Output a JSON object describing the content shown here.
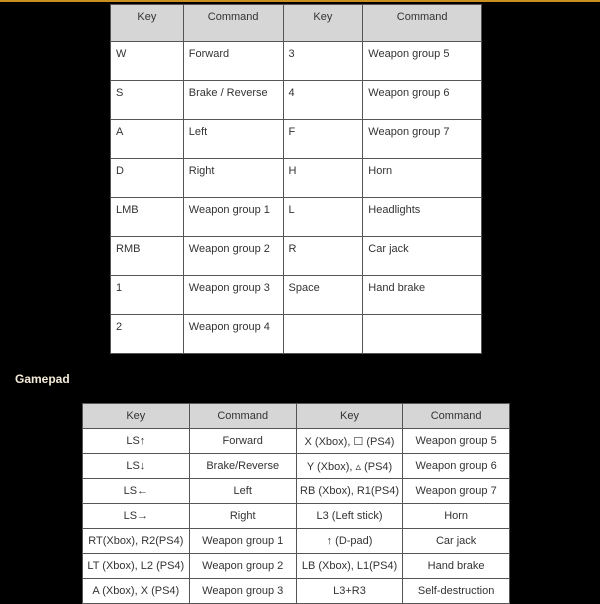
{
  "accent_color": "#c8901c",
  "keyboard": {
    "headers": [
      "Key",
      "Command",
      "Key",
      "Command"
    ],
    "rows": [
      {
        "key1": "W",
        "cmd1": "Forward",
        "key2": "3",
        "cmd2": "Weapon group 5"
      },
      {
        "key1": "S",
        "cmd1": "Brake / Reverse",
        "key2": "4",
        "cmd2": "Weapon group 6"
      },
      {
        "key1": "A",
        "cmd1": "Left",
        "key2": "F",
        "cmd2": "Weapon group 7"
      },
      {
        "key1": "D",
        "cmd1": "Right",
        "key2": "H",
        "cmd2": "Horn"
      },
      {
        "key1": "LMB",
        "cmd1": "Weapon group 1",
        "key2": "L",
        "cmd2": "Headlights"
      },
      {
        "key1": "RMB",
        "cmd1": "Weapon group 2",
        "key2": "R",
        "cmd2": "Car jack"
      },
      {
        "key1": "1",
        "cmd1": "Weapon group 3",
        "key2": "Space",
        "cmd2": "Hand brake"
      },
      {
        "key1": "2",
        "cmd1": "Weapon group 4",
        "key2": "",
        "cmd2": ""
      }
    ]
  },
  "gamepad": {
    "heading": "Gamepad",
    "headers": [
      "Key",
      "Command",
      "Key",
      "Command"
    ],
    "rows": [
      {
        "key1": "LS↑",
        "cmd1": "Forward",
        "key2": "X (Xbox), ☐ (PS4)",
        "cmd2": "Weapon group 5"
      },
      {
        "key1": "LS↓",
        "cmd1": "Brake/Reverse",
        "key2": "Y (Xbox), ▵ (PS4)",
        "cmd2": "Weapon group 6"
      },
      {
        "key1": "LS←",
        "cmd1": "Left",
        "key2": "RB (Xbox), R1(PS4)",
        "cmd2": "Weapon group 7"
      },
      {
        "key1": "LS→",
        "cmd1": "Right",
        "key2": "L3 (Left stick)",
        "cmd2": "Horn"
      },
      {
        "key1": "RT(Xbox), R2(PS4)",
        "cmd1": "Weapon group 1",
        "key2": "↑ (D-pad)",
        "cmd2": "Car jack"
      },
      {
        "key1": "LT (Xbox), L2 (PS4)",
        "cmd1": "Weapon group 2",
        "key2": "LB (Xbox), L1(PS4)",
        "cmd2": "Hand brake"
      },
      {
        "key1": "A (Xbox), X (PS4)",
        "cmd1": "Weapon group 3",
        "key2": "L3+R3",
        "cmd2": "Self-destruction"
      }
    ]
  }
}
